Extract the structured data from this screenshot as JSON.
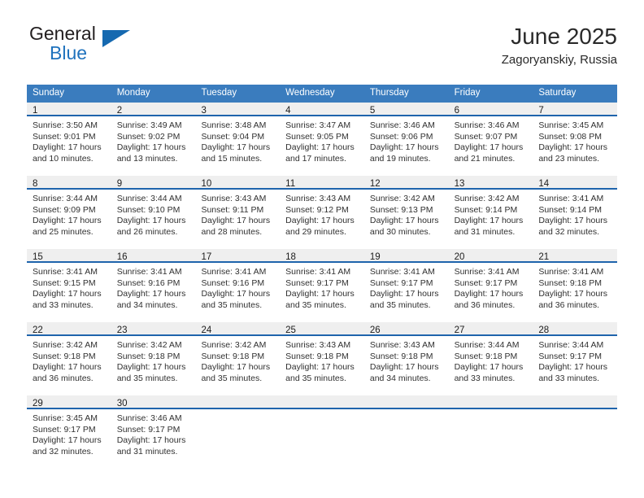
{
  "brand": {
    "name_top": "General",
    "name_bottom": "Blue",
    "triangle_color": "#1569b0",
    "blue_text_color": "#1f72bd"
  },
  "header": {
    "title": "June 2025",
    "subtitle": "Zagoryanskiy, Russia"
  },
  "theme": {
    "header_row_bg": "#3a7cbe",
    "header_row_text": "#ffffff",
    "daynum_band_bg": "#efefef",
    "daynum_underline": "#1f64ac",
    "body_text": "#303030"
  },
  "weekdays": [
    "Sunday",
    "Monday",
    "Tuesday",
    "Wednesday",
    "Thursday",
    "Friday",
    "Saturday"
  ],
  "weeks": [
    [
      {
        "day": "1",
        "sunrise": "Sunrise: 3:50 AM",
        "sunset": "Sunset: 9:01 PM",
        "daylight1": "Daylight: 17 hours",
        "daylight2": "and 10 minutes."
      },
      {
        "day": "2",
        "sunrise": "Sunrise: 3:49 AM",
        "sunset": "Sunset: 9:02 PM",
        "daylight1": "Daylight: 17 hours",
        "daylight2": "and 13 minutes."
      },
      {
        "day": "3",
        "sunrise": "Sunrise: 3:48 AM",
        "sunset": "Sunset: 9:04 PM",
        "daylight1": "Daylight: 17 hours",
        "daylight2": "and 15 minutes."
      },
      {
        "day": "4",
        "sunrise": "Sunrise: 3:47 AM",
        "sunset": "Sunset: 9:05 PM",
        "daylight1": "Daylight: 17 hours",
        "daylight2": "and 17 minutes."
      },
      {
        "day": "5",
        "sunrise": "Sunrise: 3:46 AM",
        "sunset": "Sunset: 9:06 PM",
        "daylight1": "Daylight: 17 hours",
        "daylight2": "and 19 minutes."
      },
      {
        "day": "6",
        "sunrise": "Sunrise: 3:46 AM",
        "sunset": "Sunset: 9:07 PM",
        "daylight1": "Daylight: 17 hours",
        "daylight2": "and 21 minutes."
      },
      {
        "day": "7",
        "sunrise": "Sunrise: 3:45 AM",
        "sunset": "Sunset: 9:08 PM",
        "daylight1": "Daylight: 17 hours",
        "daylight2": "and 23 minutes."
      }
    ],
    [
      {
        "day": "8",
        "sunrise": "Sunrise: 3:44 AM",
        "sunset": "Sunset: 9:09 PM",
        "daylight1": "Daylight: 17 hours",
        "daylight2": "and 25 minutes."
      },
      {
        "day": "9",
        "sunrise": "Sunrise: 3:44 AM",
        "sunset": "Sunset: 9:10 PM",
        "daylight1": "Daylight: 17 hours",
        "daylight2": "and 26 minutes."
      },
      {
        "day": "10",
        "sunrise": "Sunrise: 3:43 AM",
        "sunset": "Sunset: 9:11 PM",
        "daylight1": "Daylight: 17 hours",
        "daylight2": "and 28 minutes."
      },
      {
        "day": "11",
        "sunrise": "Sunrise: 3:43 AM",
        "sunset": "Sunset: 9:12 PM",
        "daylight1": "Daylight: 17 hours",
        "daylight2": "and 29 minutes."
      },
      {
        "day": "12",
        "sunrise": "Sunrise: 3:42 AM",
        "sunset": "Sunset: 9:13 PM",
        "daylight1": "Daylight: 17 hours",
        "daylight2": "and 30 minutes."
      },
      {
        "day": "13",
        "sunrise": "Sunrise: 3:42 AM",
        "sunset": "Sunset: 9:14 PM",
        "daylight1": "Daylight: 17 hours",
        "daylight2": "and 31 minutes."
      },
      {
        "day": "14",
        "sunrise": "Sunrise: 3:41 AM",
        "sunset": "Sunset: 9:14 PM",
        "daylight1": "Daylight: 17 hours",
        "daylight2": "and 32 minutes."
      }
    ],
    [
      {
        "day": "15",
        "sunrise": "Sunrise: 3:41 AM",
        "sunset": "Sunset: 9:15 PM",
        "daylight1": "Daylight: 17 hours",
        "daylight2": "and 33 minutes."
      },
      {
        "day": "16",
        "sunrise": "Sunrise: 3:41 AM",
        "sunset": "Sunset: 9:16 PM",
        "daylight1": "Daylight: 17 hours",
        "daylight2": "and 34 minutes."
      },
      {
        "day": "17",
        "sunrise": "Sunrise: 3:41 AM",
        "sunset": "Sunset: 9:16 PM",
        "daylight1": "Daylight: 17 hours",
        "daylight2": "and 35 minutes."
      },
      {
        "day": "18",
        "sunrise": "Sunrise: 3:41 AM",
        "sunset": "Sunset: 9:17 PM",
        "daylight1": "Daylight: 17 hours",
        "daylight2": "and 35 minutes."
      },
      {
        "day": "19",
        "sunrise": "Sunrise: 3:41 AM",
        "sunset": "Sunset: 9:17 PM",
        "daylight1": "Daylight: 17 hours",
        "daylight2": "and 35 minutes."
      },
      {
        "day": "20",
        "sunrise": "Sunrise: 3:41 AM",
        "sunset": "Sunset: 9:17 PM",
        "daylight1": "Daylight: 17 hours",
        "daylight2": "and 36 minutes."
      },
      {
        "day": "21",
        "sunrise": "Sunrise: 3:41 AM",
        "sunset": "Sunset: 9:18 PM",
        "daylight1": "Daylight: 17 hours",
        "daylight2": "and 36 minutes."
      }
    ],
    [
      {
        "day": "22",
        "sunrise": "Sunrise: 3:42 AM",
        "sunset": "Sunset: 9:18 PM",
        "daylight1": "Daylight: 17 hours",
        "daylight2": "and 36 minutes."
      },
      {
        "day": "23",
        "sunrise": "Sunrise: 3:42 AM",
        "sunset": "Sunset: 9:18 PM",
        "daylight1": "Daylight: 17 hours",
        "daylight2": "and 35 minutes."
      },
      {
        "day": "24",
        "sunrise": "Sunrise: 3:42 AM",
        "sunset": "Sunset: 9:18 PM",
        "daylight1": "Daylight: 17 hours",
        "daylight2": "and 35 minutes."
      },
      {
        "day": "25",
        "sunrise": "Sunrise: 3:43 AM",
        "sunset": "Sunset: 9:18 PM",
        "daylight1": "Daylight: 17 hours",
        "daylight2": "and 35 minutes."
      },
      {
        "day": "26",
        "sunrise": "Sunrise: 3:43 AM",
        "sunset": "Sunset: 9:18 PM",
        "daylight1": "Daylight: 17 hours",
        "daylight2": "and 34 minutes."
      },
      {
        "day": "27",
        "sunrise": "Sunrise: 3:44 AM",
        "sunset": "Sunset: 9:18 PM",
        "daylight1": "Daylight: 17 hours",
        "daylight2": "and 33 minutes."
      },
      {
        "day": "28",
        "sunrise": "Sunrise: 3:44 AM",
        "sunset": "Sunset: 9:17 PM",
        "daylight1": "Daylight: 17 hours",
        "daylight2": "and 33 minutes."
      }
    ],
    [
      {
        "day": "29",
        "sunrise": "Sunrise: 3:45 AM",
        "sunset": "Sunset: 9:17 PM",
        "daylight1": "Daylight: 17 hours",
        "daylight2": "and 32 minutes."
      },
      {
        "day": "30",
        "sunrise": "Sunrise: 3:46 AM",
        "sunset": "Sunset: 9:17 PM",
        "daylight1": "Daylight: 17 hours",
        "daylight2": "and 31 minutes."
      },
      {
        "day": "",
        "sunrise": "",
        "sunset": "",
        "daylight1": "",
        "daylight2": ""
      },
      {
        "day": "",
        "sunrise": "",
        "sunset": "",
        "daylight1": "",
        "daylight2": ""
      },
      {
        "day": "",
        "sunrise": "",
        "sunset": "",
        "daylight1": "",
        "daylight2": ""
      },
      {
        "day": "",
        "sunrise": "",
        "sunset": "",
        "daylight1": "",
        "daylight2": ""
      },
      {
        "day": "",
        "sunrise": "",
        "sunset": "",
        "daylight1": "",
        "daylight2": ""
      }
    ]
  ]
}
